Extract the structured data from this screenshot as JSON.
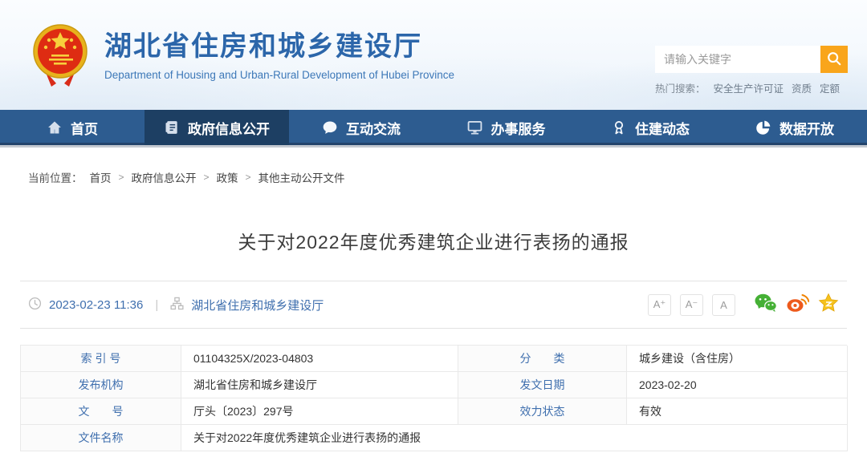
{
  "header": {
    "site_title": "湖北省住房和城乡建设厅",
    "site_subtitle": "Department of Housing and Urban-Rural Development of Hubei Province",
    "search": {
      "placeholder": "请输入关键字",
      "hot_label": "热门搜索：",
      "hot_links": [
        "安全生产许可证",
        "资质",
        "定额"
      ]
    }
  },
  "nav": {
    "items": [
      {
        "label": "首页",
        "icon": "home-icon",
        "active": false
      },
      {
        "label": "政府信息公开",
        "icon": "document-icon",
        "active": true
      },
      {
        "label": "互动交流",
        "icon": "chat-bubble-icon",
        "active": false
      },
      {
        "label": "办事服务",
        "icon": "monitor-icon",
        "active": false
      },
      {
        "label": "住建动态",
        "icon": "medal-icon",
        "active": false
      },
      {
        "label": "数据开放",
        "icon": "pie-chart-icon",
        "active": false
      }
    ]
  },
  "breadcrumb": {
    "label": "当前位置：",
    "separator": ">",
    "items": [
      "首页",
      "政府信息公开",
      "政策",
      "其他主动公开文件"
    ]
  },
  "article": {
    "title": "关于对2022年度优秀建筑企业进行表扬的通报",
    "publish_time": "2023-02-23 11:36",
    "separator": "|",
    "source": "湖北省住房和城乡建设厅",
    "font_size_buttons": [
      "A⁺",
      "A⁻",
      "A"
    ],
    "share_icons": [
      "wechat-icon",
      "weibo-icon",
      "qzone-star-icon"
    ]
  },
  "info_table": {
    "rows": [
      {
        "cells": [
          {
            "label": "索 引 号",
            "value": "01104325X/2023-04803"
          },
          {
            "label": "分　　类",
            "value": "城乡建设（含住房）"
          }
        ]
      },
      {
        "cells": [
          {
            "label": "发布机构",
            "value": "湖北省住房和城乡建设厅"
          },
          {
            "label": "发文日期",
            "value": "2023-02-20"
          }
        ]
      },
      {
        "cells": [
          {
            "label": "文　　号",
            "value": "厅头〔2023〕297号"
          },
          {
            "label": "效力状态",
            "value": "有效"
          }
        ]
      },
      {
        "cells": [
          {
            "label": "文件名称",
            "value": "关于对2022年度优秀建筑企业进行表扬的通报"
          }
        ]
      }
    ]
  },
  "colors": {
    "brand_blue": "#2c66aa",
    "nav_blue": "#2d5c90",
    "nav_active_blue": "#1d3f63",
    "accent_orange": "#f9a51b",
    "link_blue": "#3f6fae",
    "wechat_green": "#45b035",
    "weibo_orange": "#ed5a1c",
    "qzone_gold": "#f5c21c"
  }
}
